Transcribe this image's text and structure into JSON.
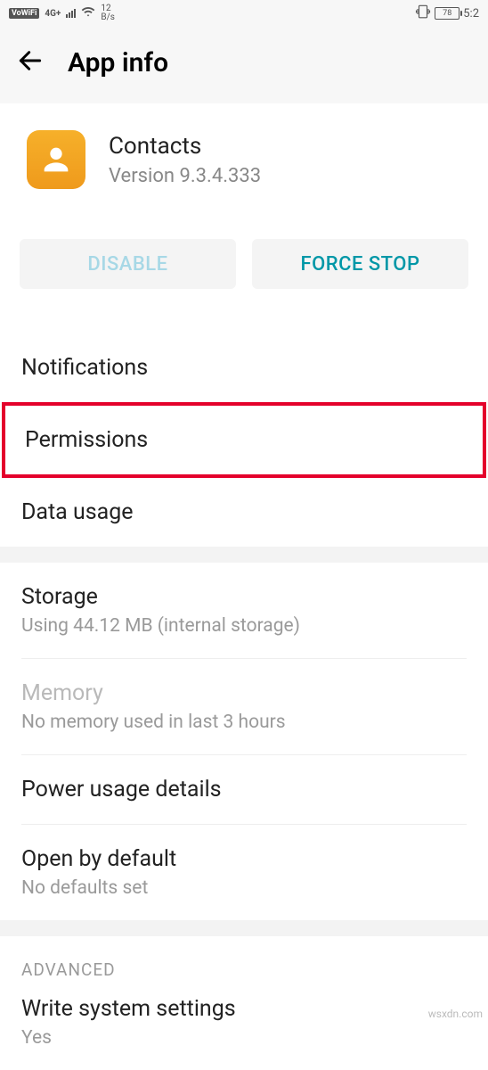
{
  "status": {
    "vowifi": "VoWiFi",
    "net": "4G+",
    "speed_top": "12",
    "speed_bot": "B/s",
    "battery": "78",
    "time": "5:2"
  },
  "header": {
    "title": "App info"
  },
  "app": {
    "name": "Contacts",
    "version": "Version 9.3.4.333"
  },
  "actions": {
    "disable": "DISABLE",
    "force_stop": "FORCE STOP"
  },
  "rows": {
    "notifications": "Notifications",
    "permissions": "Permissions",
    "data_usage": "Data usage",
    "storage": {
      "title": "Storage",
      "sub": "Using 44.12 MB (internal storage)"
    },
    "memory": {
      "title": "Memory",
      "sub": "No memory used in last 3 hours"
    },
    "power": "Power usage details",
    "open_default": {
      "title": "Open by default",
      "sub": "No defaults set"
    }
  },
  "advanced": {
    "header": "ADVANCED",
    "write_settings": {
      "title": "Write system settings",
      "sub": "Yes"
    }
  },
  "watermark": "wsxdn.com"
}
